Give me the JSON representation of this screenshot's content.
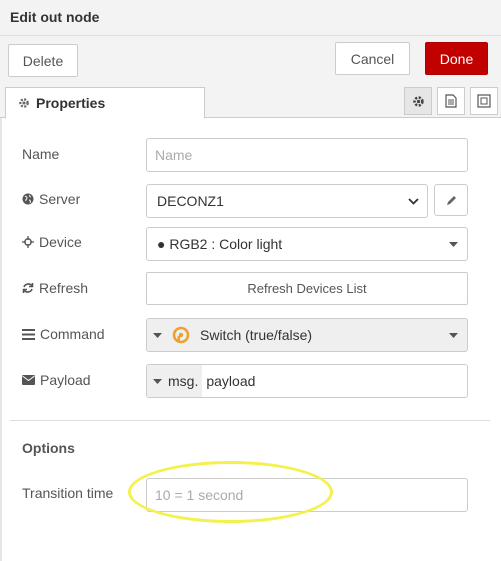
{
  "window": {
    "title": "Edit out node"
  },
  "toolbar": {
    "delete_label": "Delete",
    "cancel_label": "Cancel",
    "done_label": "Done"
  },
  "tabs": {
    "properties_label": "Properties"
  },
  "form": {
    "name": {
      "label": "Name",
      "placeholder": "Name",
      "value": ""
    },
    "server": {
      "label": "Server",
      "value": "DECONZ1"
    },
    "device": {
      "label": "Device",
      "value": "● RGB2 : Color light"
    },
    "refresh": {
      "label": "Refresh",
      "button_label": "Refresh Devices List"
    },
    "command": {
      "label": "Command",
      "value": "Switch (true/false)"
    },
    "payload": {
      "label": "Payload",
      "type_prefix": "msg.",
      "value": "payload"
    }
  },
  "options": {
    "heading": "Options",
    "transition": {
      "label": "Transition time",
      "placeholder": "10 = 1 second",
      "value": ""
    }
  },
  "colors": {
    "accent": "#c10000",
    "highlight": "#f3f14a",
    "command_icon": "#f0a030"
  }
}
